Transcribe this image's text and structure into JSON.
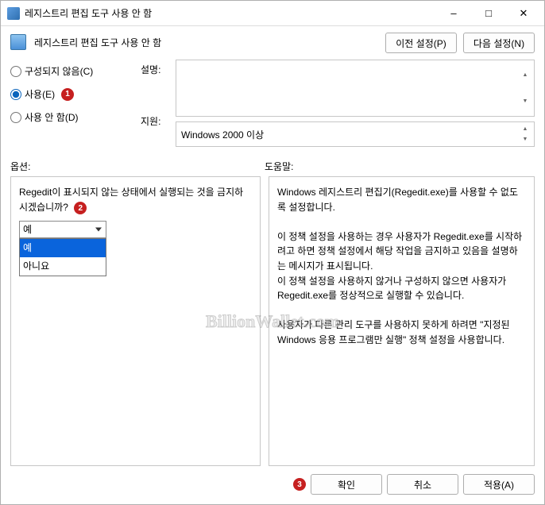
{
  "window": {
    "title": "레지스트리 편집 도구 사용 안 함"
  },
  "header": {
    "policy_title": "레지스트리 편집 도구 사용 안 함",
    "prev_btn": "이전 설정(P)",
    "next_btn": "다음 설정(N)"
  },
  "radios": {
    "not_configured": "구성되지 않음(C)",
    "enabled": "사용(E)",
    "disabled": "사용 안 함(D)",
    "selected": "enabled"
  },
  "fields": {
    "comment_label": "설명:",
    "comment_value": "",
    "supported_label": "지원:",
    "supported_value": "Windows 2000 이상"
  },
  "sections": {
    "options_label": "옵션:",
    "help_label": "도움말:"
  },
  "options": {
    "question": "Regedit이 표시되지 않는 상태에서 실행되는 것을 금지하시겠습니까?",
    "select_value": "예",
    "dropdown_items": [
      "예",
      "아니요"
    ],
    "dropdown_selected_index": 0
  },
  "help": {
    "p1": "Windows 레지스트리 편집기(Regedit.exe)를 사용할 수 없도록 설정합니다.",
    "p2": "이 정책 설정을 사용하는 경우 사용자가 Regedit.exe를 시작하려고 하면 정책 설정에서 해당 작업을 금지하고 있음을 설명하는 메시지가 표시됩니다.",
    "p3": "이 정책 설정을 사용하지 않거나 구성하지 않으면 사용자가 Regedit.exe를 정상적으로 실행할 수 있습니다.",
    "p4": "사용자가 다른 관리 도구를 사용하지 못하게 하려면 \"지정된 Windows 응용 프로그램만 실행\" 정책 설정을 사용합니다."
  },
  "footer": {
    "ok": "확인",
    "cancel": "취소",
    "apply": "적용(A)"
  },
  "markers": {
    "m1": "1",
    "m2": "2",
    "m3": "3"
  },
  "watermark": "BillionWallet.com"
}
